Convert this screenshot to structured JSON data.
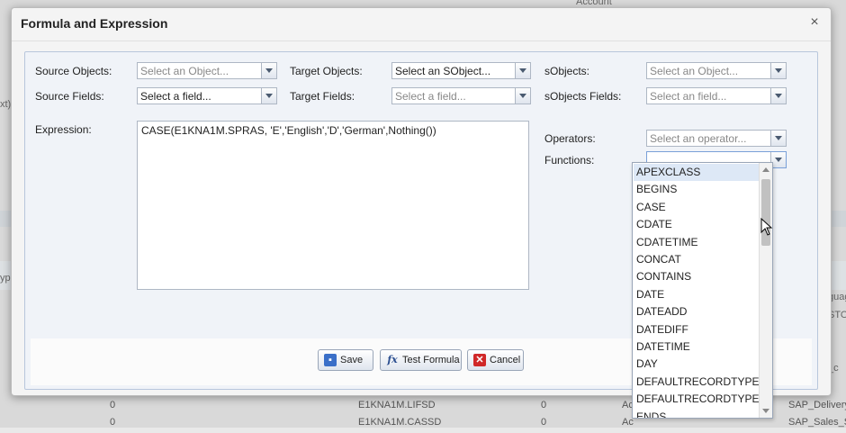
{
  "dialog": {
    "title": "Formula and Expression",
    "close_symbol": "×"
  },
  "labels": {
    "source_objects": "Source Objects:",
    "target_objects": "Target Objects:",
    "sobjects": "sObjects:",
    "source_fields": "Source Fields:",
    "target_fields": "Target Fields:",
    "sobjects_fields": "sObjects Fields:",
    "expression": "Expression:",
    "operators": "Operators:",
    "functions": "Functions:"
  },
  "fields": {
    "source_objects": "Select an Object...",
    "target_objects": "Select an SObject...",
    "sobjects": "Select an Object...",
    "source_fields": "Select a field...",
    "target_fields": "Select a field...",
    "sobjects_fields": "Select an field...",
    "operators": "Select an operator...",
    "functions": ""
  },
  "expression": "CASE(E1KNA1M.SPRAS, 'E','English','D','German',Nothing())",
  "buttons": {
    "save": "Save",
    "test_formula": "Test Formula",
    "cancel": "Cancel",
    "fx_symbol": "fx",
    "cancel_symbol": "✕",
    "save_symbol": "▪"
  },
  "functions_list": [
    "APEXCLASS",
    "BEGINS",
    "CASE",
    "CDATE",
    "CDATETIME",
    "CONCAT",
    "CONTAINS",
    "DATE",
    "DATEADD",
    "DATEDIFF",
    "DATETIME",
    "DAY",
    "DEFAULTRECORDTYPEID",
    "DEFAULTRECORDTYPEN...",
    "ENDS"
  ],
  "background": {
    "rows": [
      {
        "c1": "0",
        "c2": "E1KNA1M.LIFSD",
        "c3": "0",
        "c4": "Ac",
        "c5": "SAP_Delivery"
      },
      {
        "c1": "0",
        "c2": "E1KNA1M.CASSD",
        "c3": "0",
        "c4": "Ac",
        "c5": "SAP_Sales_S"
      }
    ],
    "side": {
      "xt": "xt)",
      "yp": "yp",
      "guag": "guag",
      "sto": "STO",
      "c": "_c",
      "account": "Account"
    }
  }
}
